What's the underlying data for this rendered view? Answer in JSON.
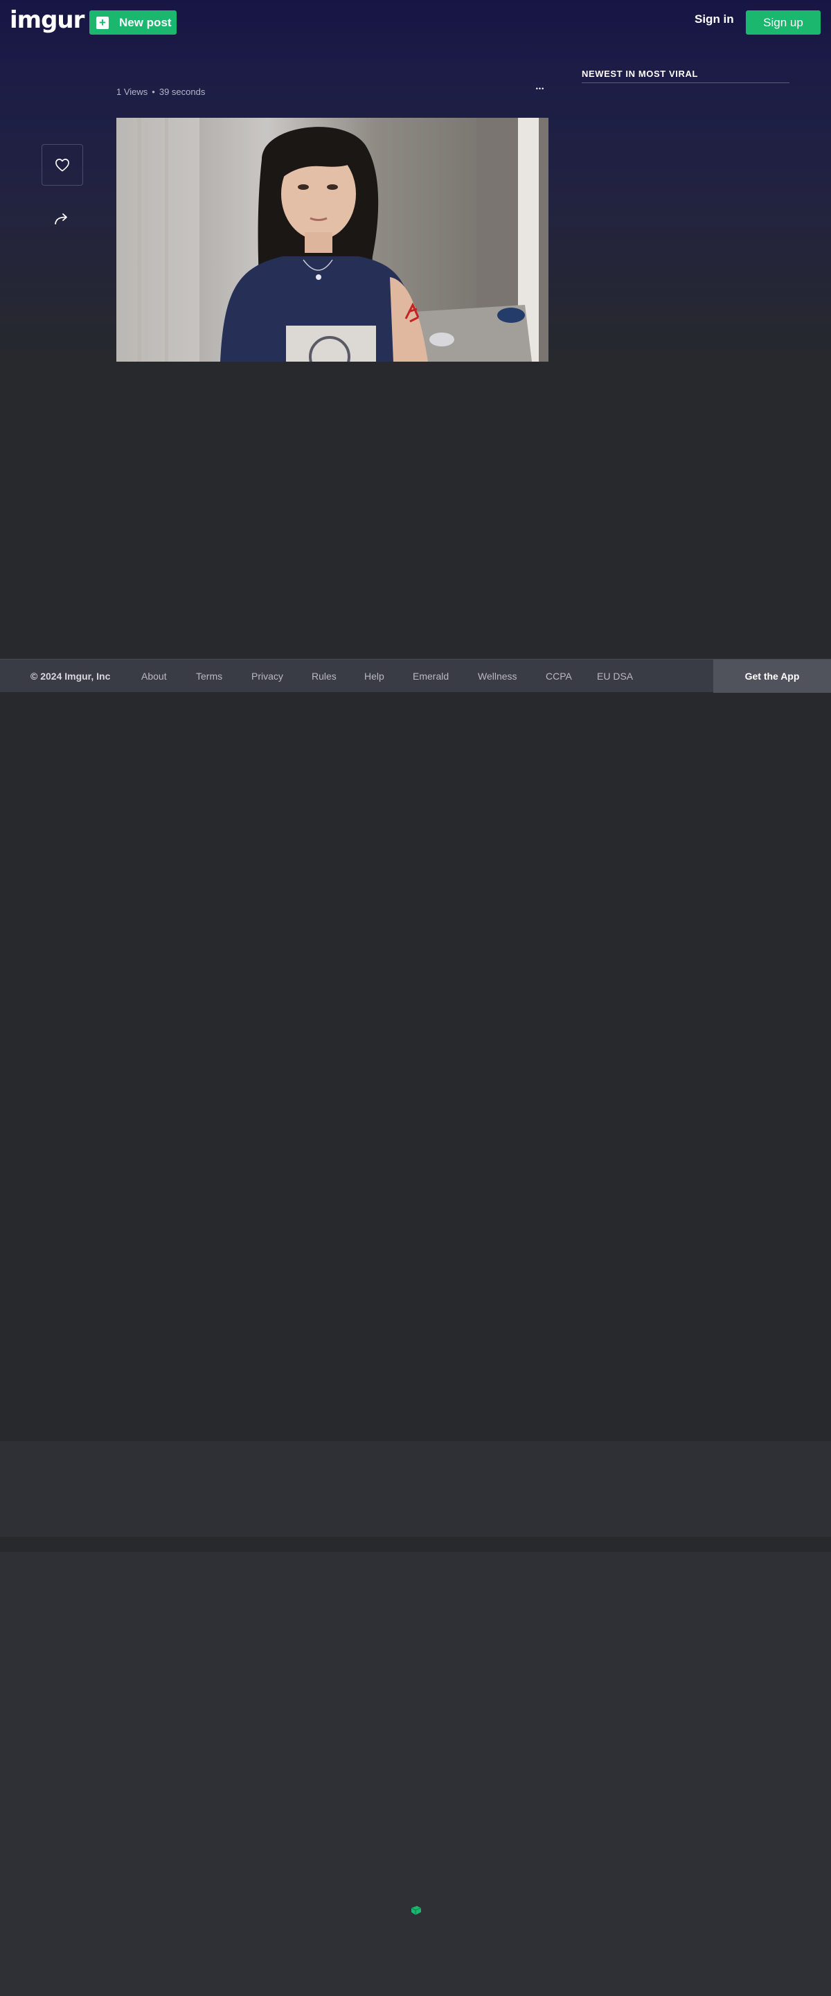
{
  "header": {
    "logo": "imgur",
    "new_post_label": "New post",
    "signin_label": "Sign in",
    "signup_label": "Sign up"
  },
  "post": {
    "views": "1 Views",
    "separator": "•",
    "age": "39 seconds",
    "more_label": "•••",
    "image_alt": "Woman in a navy t-shirt sitting in a room with red marks on her arm"
  },
  "sidebar": {
    "title": "NEWEST IN MOST VIRAL"
  },
  "footer": {
    "copyright": "© 2024 Imgur, Inc",
    "links": [
      "About",
      "Terms",
      "Privacy",
      "Rules",
      "Help",
      "Emerald",
      "Wellness",
      "CCPA",
      "EU DSA"
    ],
    "get_app": "Get the App"
  },
  "colors": {
    "accent": "#1bb76e",
    "header_bg": "#171544",
    "page_bg": "#27292d",
    "footer_bg": "#3a3c45"
  },
  "icons": {
    "like": "heart-icon",
    "share": "share-arrow-icon",
    "new_post": "plus-icon",
    "loader": "imgur-loader-icon"
  }
}
